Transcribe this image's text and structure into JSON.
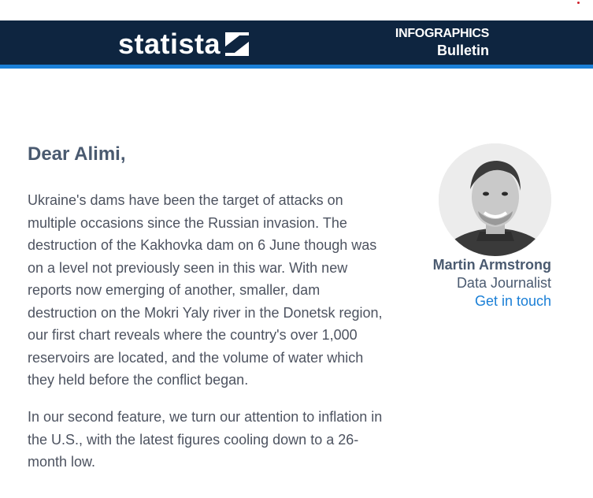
{
  "header": {
    "logo_text": "statista",
    "kicker": "INFOGRAPHICS",
    "title": "Bulletin"
  },
  "email": {
    "greeting": "Dear Alimi,",
    "paragraphs": [
      "Ukraine's dams have been the target of attacks on multiple occasions since the Russian invasion. The destruction of the Kakhovka dam on 6 June though was on a level not previously seen in this war. With new reports now emerging of another, smaller, dam destruction on the Mokri Yaly river in the Donetsk region, our first chart reveals where the country's over 1,000 reservoirs are located, and the volume of water which they held before the conflict began.",
      "In our second feature, we turn our attention to inflation in the U.S., with the latest figures cooling down to a 26-month low."
    ]
  },
  "author": {
    "name": "Martin Armstrong",
    "role": "Data Journalist",
    "contact_label": "Get in touch"
  },
  "colors": {
    "header_bg": "#0e2540",
    "accent_blue": "#1a7fd6",
    "heading_text": "#4a5a70",
    "body_text": "#4d5360"
  },
  "icons": {
    "logo_mark": "statista-logo-icon",
    "avatar": "author-photo"
  }
}
